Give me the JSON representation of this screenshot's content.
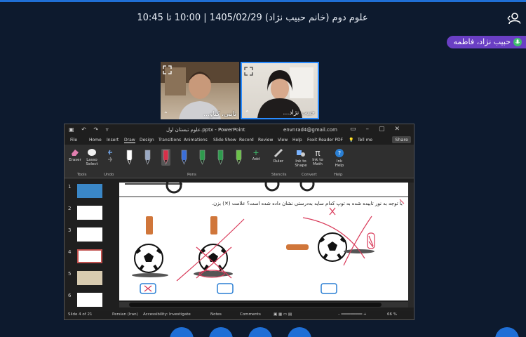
{
  "meeting": {
    "title": "علوم دوم (خانم حبیب نژاد) 1405/02/29 | 10:00 تا 10:45",
    "active_speaker": "حبیب نژاد، فاطمه"
  },
  "video_tiles": [
    {
      "name": "نایبی، کیاو…"
    },
    {
      "name": "حبیب نژاد…"
    }
  ],
  "powerpoint": {
    "file_name": "علوم تبستان اول.pptx - PowerPoint",
    "account": "envnrad4@gmail.com",
    "tabs": [
      "File",
      "Home",
      "Insert",
      "Draw",
      "Design",
      "Transitions",
      "Animations",
      "Slide Show",
      "Record",
      "Review",
      "View",
      "Help",
      "Foxit Reader PDF"
    ],
    "active_tab": "Draw",
    "tell_me": "Tell me",
    "share_label": "Share",
    "ribbon": {
      "eraser": "Eraser",
      "lasso": "Lasso Select",
      "tools_group": "Tools",
      "undo_group": "Undo",
      "pens_group": "Pens",
      "add": "Add",
      "ruler": "Ruler",
      "stencils_group": "Stencils",
      "ink_to_shape": "Ink to Shape",
      "ink_to_math": "Ink to Math",
      "convert_group": "Convert",
      "ink_help": "Ink Help",
      "help_group": "Help",
      "pen_colors": [
        "#ffffff",
        "#9aa9c4",
        "#d8304a",
        "#3b6fd9",
        "#2e9b4d",
        "#2e9b4d",
        "#6cc24a"
      ]
    },
    "slide_numbers": [
      "1",
      "2",
      "3",
      "4",
      "5",
      "6"
    ],
    "selected_slide": "4",
    "slide_question": "با توجه به نور تابیده شده به توپ کدام سایه به‌درستی نشان داده شده است؟ علامت (✕) بزن.",
    "status": {
      "slide_info": "Slide 4 of 21",
      "language": "Persian (Iran)",
      "accessibility": "Accessibility: Investigate",
      "notes": "Notes",
      "comments": "Comments",
      "zoom": "66 %"
    }
  },
  "colors": {
    "background": "#0d1a2e",
    "accent": "#1f6fd6",
    "speaker_badge": "#6a3fc4",
    "mark_red": "#d93b5a",
    "mark_blue": "#2a7fd4"
  }
}
